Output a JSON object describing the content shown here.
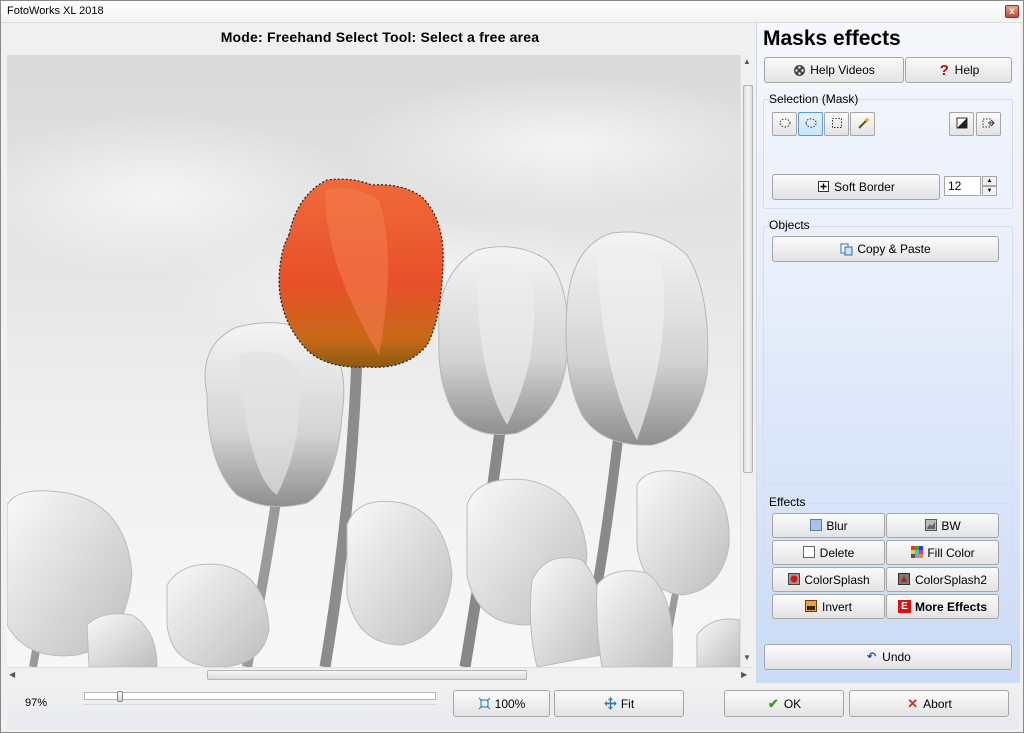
{
  "window": {
    "title": "FotoWorks XL 2018",
    "close_glyph": "x"
  },
  "canvas": {
    "mode_label": "Mode: Freehand Select Tool: Select a free area",
    "scroll_vertical_label": "scrollbar-vertical",
    "scroll_horizontal_grip": "III"
  },
  "side": {
    "title": "Masks effects",
    "help_videos": "Help Videos",
    "help": "Help",
    "selection_label": "Selection (Mask)",
    "soft_border": "Soft Border",
    "soft_border_value": "12",
    "objects_label": "Objects",
    "copy_paste": "Copy & Paste",
    "effects_label": "Effects",
    "effects": [
      "Blur",
      "BW",
      "Delete",
      "Fill Color",
      "ColorSplash",
      "ColorSplash2",
      "Invert",
      "More Effects"
    ],
    "undo": "Undo"
  },
  "bottom": {
    "zoom_percent": "97%",
    "zoom_100": "100%",
    "fit": "Fit",
    "ok": "OK",
    "abort": "Abort"
  },
  "colors": {
    "accent_blue": "#c9dbf7",
    "ok_green": "#3a9a2a",
    "abort_red": "#c0392b",
    "tulip_orange": "#e8502a"
  },
  "icons": [
    "film-reel-icon",
    "question-icon",
    "ellipse-select-icon",
    "freehand-select-icon",
    "rect-select-icon",
    "magic-wand-icon",
    "invert-selection-icon",
    "export-selection-icon",
    "plus-box-icon",
    "copy-paste-icon",
    "blur-icon",
    "bw-icon",
    "delete-icon",
    "fill-color-icon",
    "colorsplash-icon",
    "colorsplash2-icon",
    "invert-icon",
    "more-effects-icon",
    "undo-icon",
    "zoom-100-icon",
    "fit-icon",
    "checkmark-icon",
    "x-icon"
  ]
}
